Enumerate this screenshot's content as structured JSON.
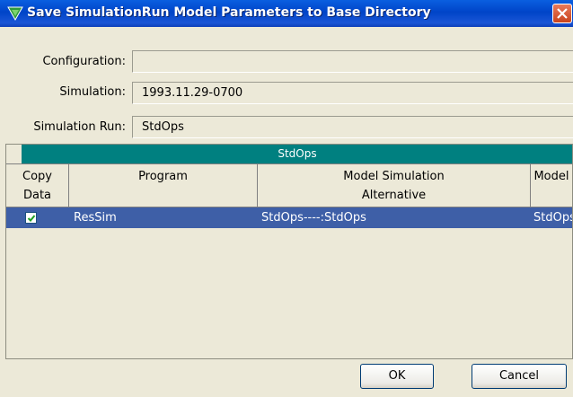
{
  "window": {
    "title": "Save SimulationRun Model Parameters to Base Directory"
  },
  "form": {
    "configuration_label": "Configuration:",
    "configuration_value": "",
    "simulation_label": "Simulation:",
    "simulation_value": "1993.11.29-0700",
    "simulation_run_label": "Simulation Run:",
    "simulation_run_value": "StdOps"
  },
  "table": {
    "group_header": "StdOps",
    "columns": {
      "copy_data_line1": "Copy",
      "copy_data_line2": "Data",
      "program": "Program",
      "alternative_line1": "Model Simulation",
      "alternative_line2": "Alternative",
      "model": "Model"
    },
    "rows": [
      {
        "copy_data": true,
        "program": "ResSim",
        "alternative": "StdOps----:StdOps",
        "model": "StdOps..."
      }
    ],
    "selected_row_color": "#3e5fa7",
    "header_color": "#008080"
  },
  "buttons": {
    "ok_label": "OK",
    "cancel_label": "Cancel"
  }
}
